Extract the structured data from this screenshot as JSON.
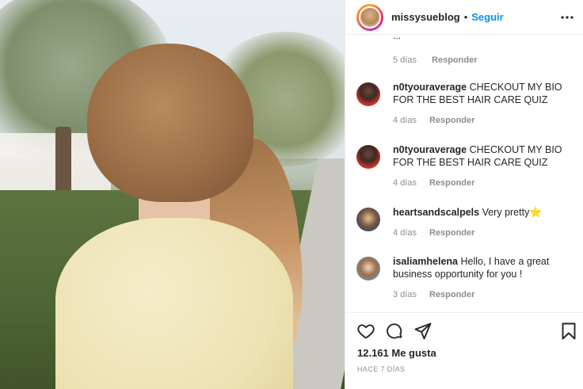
{
  "post": {
    "username": "missysueblog",
    "separator": "•",
    "follow_label": "Seguir"
  },
  "comments": {
    "partial_text": "...",
    "first_meta": {
      "time": "5 días",
      "reply_label": "Responder"
    },
    "items": [
      {
        "username": "n0tyouraverage",
        "text": "CHECKOUT MY BIO FOR THE BEST HAIR CARE QUIZ",
        "time": "4 días",
        "reply_label": "Responder"
      },
      {
        "username": "n0tyouraverage",
        "text": "CHECKOUT MY BIO FOR THE BEST HAIR CARE QUIZ",
        "time": "4 días",
        "reply_label": "Responder"
      },
      {
        "username": "heartsandscalpels",
        "text": "Very pretty",
        "emoji": "⭐",
        "time": "4 días",
        "reply_label": "Responder"
      },
      {
        "username": "isaliamhelena",
        "text": "Hello, I have a great business opportunity for you !",
        "time": "3 días",
        "reply_label": "Responder"
      }
    ]
  },
  "footer": {
    "likes": "12.161 Me gusta",
    "date": "HACE 7 DÍAS"
  },
  "icons": [
    "more-options-icon",
    "heart-icon",
    "comment-icon",
    "share-icon",
    "bookmark-icon"
  ],
  "colors": {
    "link": "#0095f6",
    "muted": "#8e8e8e",
    "text": "#262626",
    "star": "#f3c316"
  }
}
